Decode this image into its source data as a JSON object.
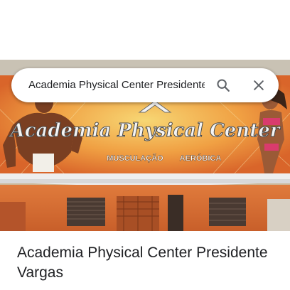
{
  "search": {
    "query": "Academia Physical Center Presidente Vargas"
  },
  "photo": {
    "sign_text": "Academia Physical Center",
    "sign_services": [
      "MUSCULAÇÃO",
      "AERÓBICA"
    ]
  },
  "place": {
    "name": "Academia Physical Center Presidente Vargas"
  },
  "icons": {
    "search": "search-icon",
    "close": "close-icon"
  },
  "colors": {
    "sign_orange": "#e8742a",
    "sign_yellow": "#f3c14b",
    "text_primary": "#202124",
    "icon_gray": "#5f6368"
  }
}
